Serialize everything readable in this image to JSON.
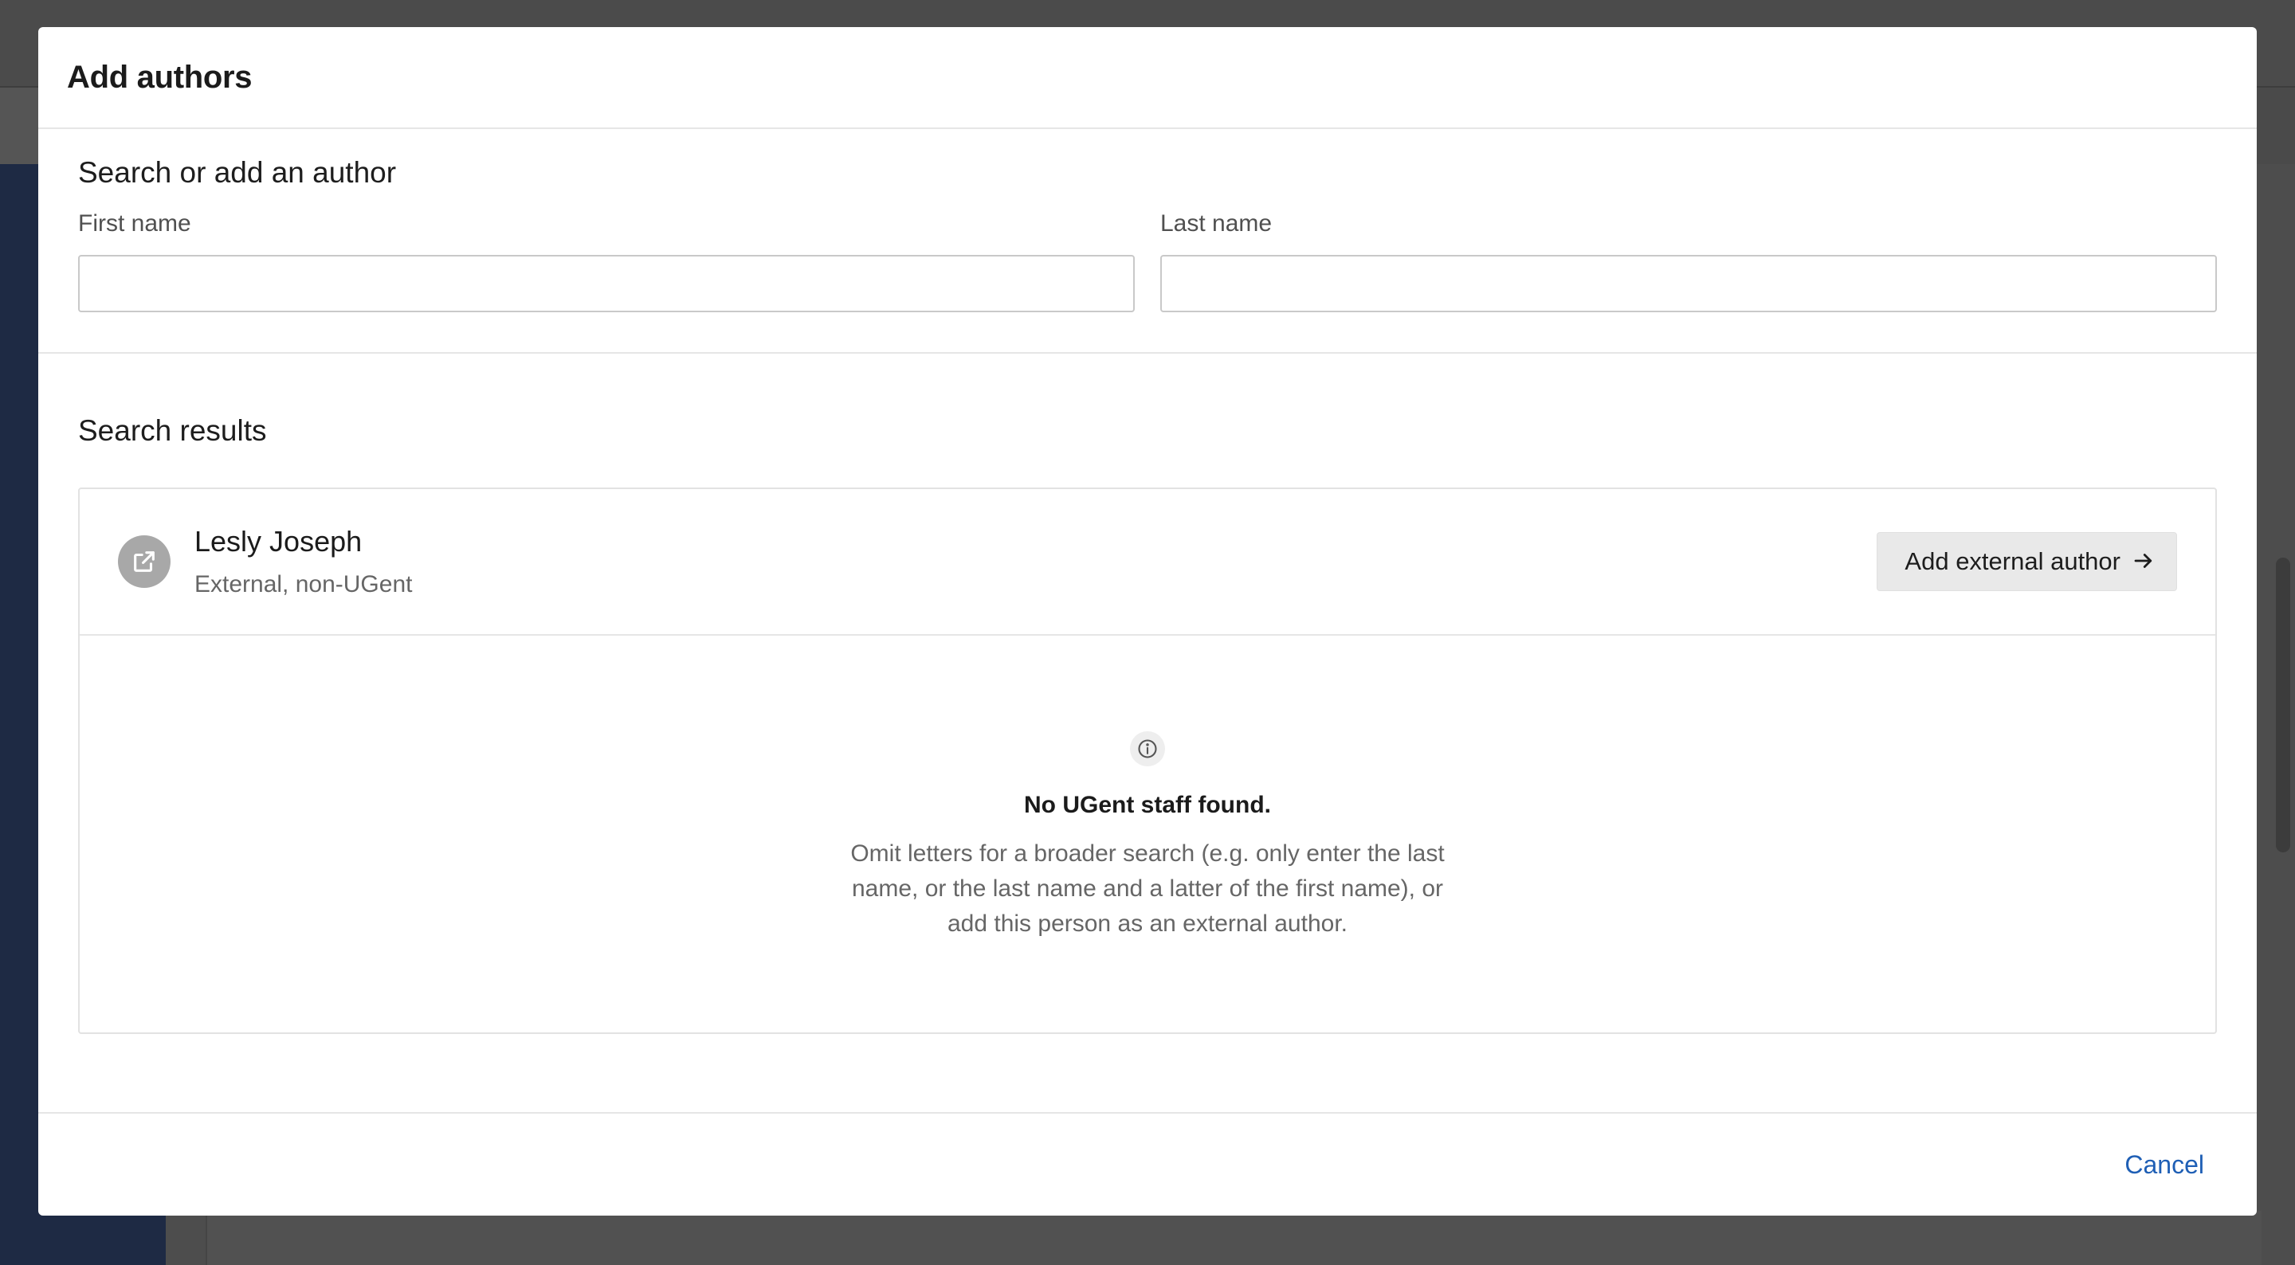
{
  "modal": {
    "title": "Add authors"
  },
  "search": {
    "section_title": "Search or add an author",
    "first_name_label": "First name",
    "first_name_value": "",
    "last_name_label": "Last name",
    "last_name_value": ""
  },
  "results": {
    "section_title": "Search results",
    "items": [
      {
        "name": "Lesly Joseph",
        "meta": "External, non-UGent",
        "icon": "external-link-icon",
        "action_label": "Add external author",
        "action_icon": "arrow-right-icon"
      }
    ],
    "empty_state": {
      "icon": "info-icon",
      "title": "No UGent staff found.",
      "description": "Omit letters for a broader search (e.g. only enter the last name, or the last name and a latter of the first name), or add this person as an external author."
    }
  },
  "footer": {
    "cancel_label": "Cancel"
  },
  "colors": {
    "link": "#1f5fb5",
    "overlay": "#4a4a4a",
    "sidebar": "#1e2a44"
  }
}
